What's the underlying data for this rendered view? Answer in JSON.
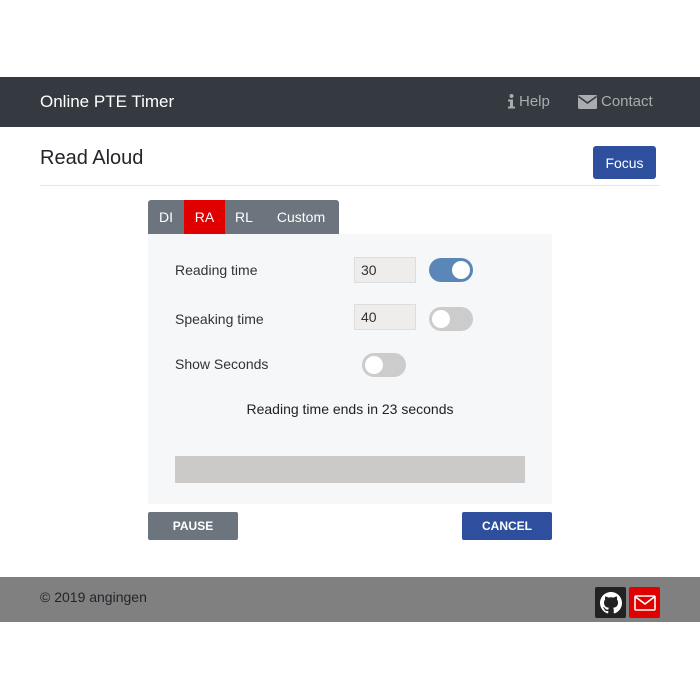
{
  "navbar": {
    "brand": "Online PTE Timer",
    "help_label": "Help",
    "contact_label": "Contact"
  },
  "page": {
    "title": "Read Aloud",
    "focus_label": "Focus"
  },
  "tabs": [
    {
      "label": "DI",
      "active": false
    },
    {
      "label": "RA",
      "active": true
    },
    {
      "label": "RL",
      "active": false
    },
    {
      "label": "Custom",
      "active": false
    }
  ],
  "settings": {
    "reading_time": {
      "label": "Reading time",
      "value": "30",
      "toggle_on": true
    },
    "speaking_time": {
      "label": "Speaking time",
      "value": "40",
      "toggle_on": false
    },
    "show_seconds": {
      "label": "Show Seconds",
      "toggle_on": false
    }
  },
  "status_text": "Reading time ends in 23 seconds",
  "progress": 0,
  "buttons": {
    "pause": "PAUSE",
    "cancel": "CANCEL"
  },
  "footer": {
    "copyright": "© 2019 angingen"
  },
  "colors": {
    "navbar": "#343a40",
    "primary": "#2d4f9e",
    "active_tab": "#e00000",
    "toggle_on": "#5b86b8"
  }
}
